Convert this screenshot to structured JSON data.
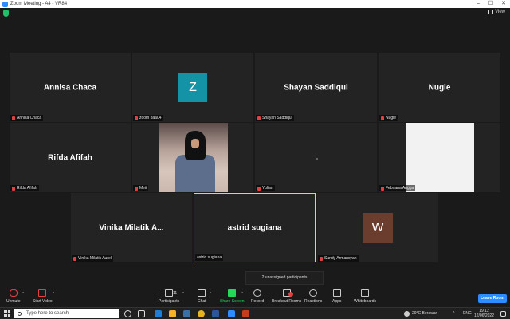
{
  "window": {
    "title": "Zoom Meeting - A4 - VR84",
    "controls": {
      "minimize": "–",
      "maximize": "☐",
      "close": "✕"
    }
  },
  "topbar": {
    "view_label": "View"
  },
  "tiles": [
    {
      "display_name": "Annisa Chaca",
      "label": "Annisa Chaca",
      "muted": true
    },
    {
      "display_name": "",
      "avatar_letter": "Z",
      "label": "zoom baa04",
      "muted": true
    },
    {
      "display_name": "Shayan Saddiqui",
      "label": "Shayan Saddiqui",
      "muted": true
    },
    {
      "display_name": "Nugie",
      "label": "Nugie",
      "muted": true
    },
    {
      "display_name": "Rifda Afifah",
      "label": "Rifda Afifah",
      "muted": true
    },
    {
      "display_name": "",
      "label": "Meii",
      "muted": true,
      "video": true
    },
    {
      "display_name": "",
      "label": "Yulian",
      "muted": true
    },
    {
      "display_name": "",
      "label": "Febriana Angga",
      "muted": true,
      "video": true
    },
    {
      "display_name": "Vinika Milatik A...",
      "label": "Vinika Milatik Aurel",
      "muted": true
    },
    {
      "display_name": "astrid sugiana",
      "label": "astrid sugiana",
      "muted": false,
      "active": true
    },
    {
      "display_name": "",
      "avatar_letter": "W",
      "label": "Sandy Armansyah",
      "muted": true
    }
  ],
  "notice": {
    "unassigned": "2 unassigned participants"
  },
  "toolbar": {
    "unmute": "Unmute",
    "start_video": "Start Video",
    "participants": "Participants",
    "participants_count": "11",
    "chat": "Chat",
    "share_screen": "Share Screen",
    "record": "Record",
    "breakout_rooms": "Breakout Rooms",
    "reactions": "Reactions",
    "apps": "Apps",
    "whiteboards": "Whiteboards",
    "leave_room": "Leave Room",
    "caret": "^"
  },
  "taskbar": {
    "search_placeholder": "Type here to search",
    "weather": "29°C  Berawan",
    "language": "ENG",
    "time": "19:12",
    "date": "12/06/2022"
  },
  "colors": {
    "accent": "#2d8cff",
    "active_speaker_border": "#e8d84a",
    "share_green": "#23d959",
    "muted_red": "#e34141"
  }
}
